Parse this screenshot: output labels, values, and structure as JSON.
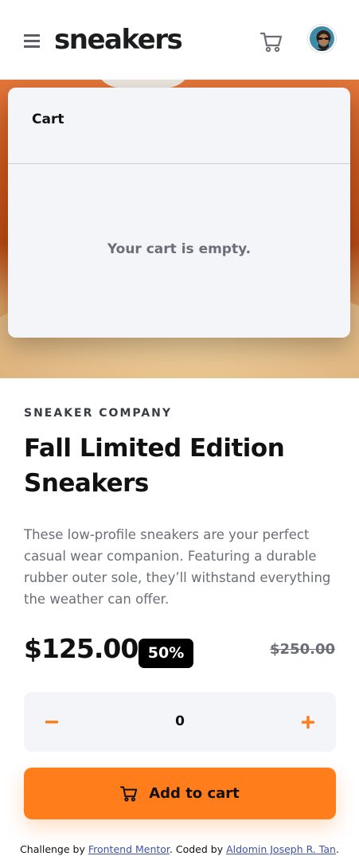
{
  "header": {
    "logo": "sneakers",
    "menu_icon": "hamburger-menu-icon",
    "cart_icon": "cart-icon",
    "avatar_icon": "user-avatar"
  },
  "cart": {
    "title": "Cart",
    "empty_message": "Your cart is empty."
  },
  "product": {
    "company": "SNEAKER COMPANY",
    "title": "Fall Limited Edition Sneakers",
    "description": "These low-profile sneakers are your perfect casual wear companion. Featuring a durable rubber outer sole, they’ll withstand everything the weather can offer.",
    "price": "$125.00",
    "discount": "50%",
    "original_price": "$250.00"
  },
  "quantity": {
    "value": "0",
    "minus_icon": "minus-icon",
    "plus_icon": "plus-icon"
  },
  "add_to_cart": {
    "label": "Add to cart",
    "icon": "cart-icon"
  },
  "footer": {
    "prefix": "Challenge by ",
    "link1": "Frontend Mentor",
    "middle": ". Coded by ",
    "link2": "Aldomin Joseph R. Tan",
    "suffix": "."
  },
  "colors": {
    "accent": "#ff7d1a",
    "dark": "#111111",
    "muted": "#6b6e76",
    "light_bg": "#f4f5f8"
  }
}
